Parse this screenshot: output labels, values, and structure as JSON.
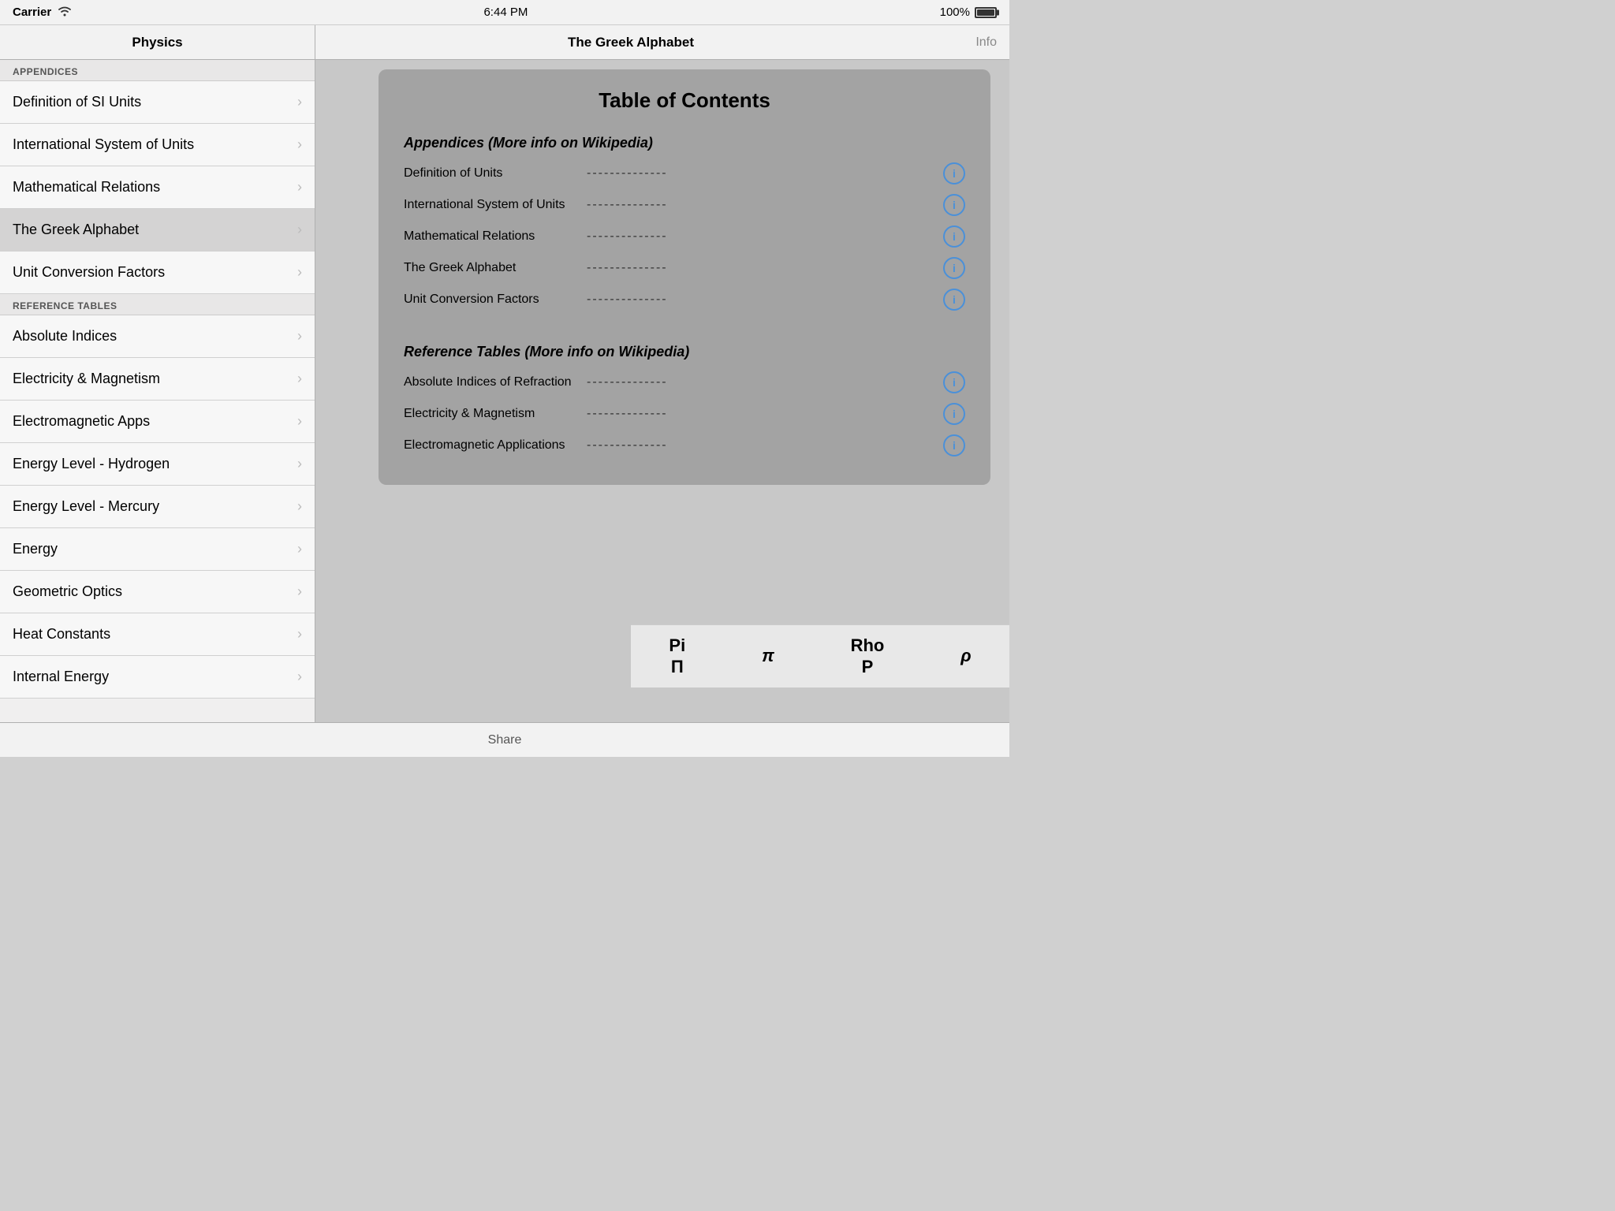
{
  "statusBar": {
    "carrier": "Carrier",
    "wifi": "wifi",
    "time": "6:44 PM",
    "battery": "100%"
  },
  "navBar": {
    "leftTitle": "Physics",
    "centerTitle": "The Greek Alphabet",
    "infoLabel": "Info"
  },
  "sidebar": {
    "sections": [
      {
        "header": "APPENDICES",
        "items": [
          {
            "label": "Definition of SI Units",
            "selected": false
          },
          {
            "label": "International System of Units",
            "selected": false
          },
          {
            "label": "Mathematical Relations",
            "selected": false
          },
          {
            "label": "The Greek Alphabet",
            "selected": true
          },
          {
            "label": "Unit Conversion Factors",
            "selected": false
          }
        ]
      },
      {
        "header": "REFERENCE TABLES",
        "items": [
          {
            "label": "Absolute Indices",
            "selected": false
          },
          {
            "label": "Electricity & Magnetism",
            "selected": false
          },
          {
            "label": "Electromagnetic Apps",
            "selected": false
          },
          {
            "label": "Energy Level - Hydrogen",
            "selected": false
          },
          {
            "label": "Energy Level - Mercury",
            "selected": false
          },
          {
            "label": "Energy",
            "selected": false
          },
          {
            "label": "Geometric Optics",
            "selected": false
          },
          {
            "label": "Heat Constants",
            "selected": false
          },
          {
            "label": "Internal Energy",
            "selected": false
          }
        ]
      }
    ]
  },
  "toc": {
    "title": "Table of Contents",
    "appendicesSection": {
      "heading": "Appendices  (More info on Wikipedia)",
      "rows": [
        {
          "label": "Definition of Units",
          "dots": "--------------"
        },
        {
          "label": "International System of Units",
          "dots": "--------------"
        },
        {
          "label": "Mathematical Relations",
          "dots": "--------------"
        },
        {
          "label": "The Greek Alphabet",
          "dots": "--------------"
        },
        {
          "label": "Unit Conversion Factors",
          "dots": "--------------"
        }
      ]
    },
    "referenceSection": {
      "heading": "Reference Tables  (More info on Wikipedia)",
      "rows": [
        {
          "label": "Absolute Indices of Refraction",
          "dots": "--------------"
        },
        {
          "label": "Electricity & Magnetism",
          "dots": "--------------"
        },
        {
          "label": "Electromagnetic Applications",
          "dots": "--------------"
        }
      ]
    }
  },
  "greekBottom": [
    {
      "name": "Pi",
      "upper": "Π",
      "lower": "π"
    },
    {
      "name": "Rho",
      "upper": "P",
      "lower": "ρ"
    }
  ],
  "shareBar": {
    "label": "Share"
  }
}
